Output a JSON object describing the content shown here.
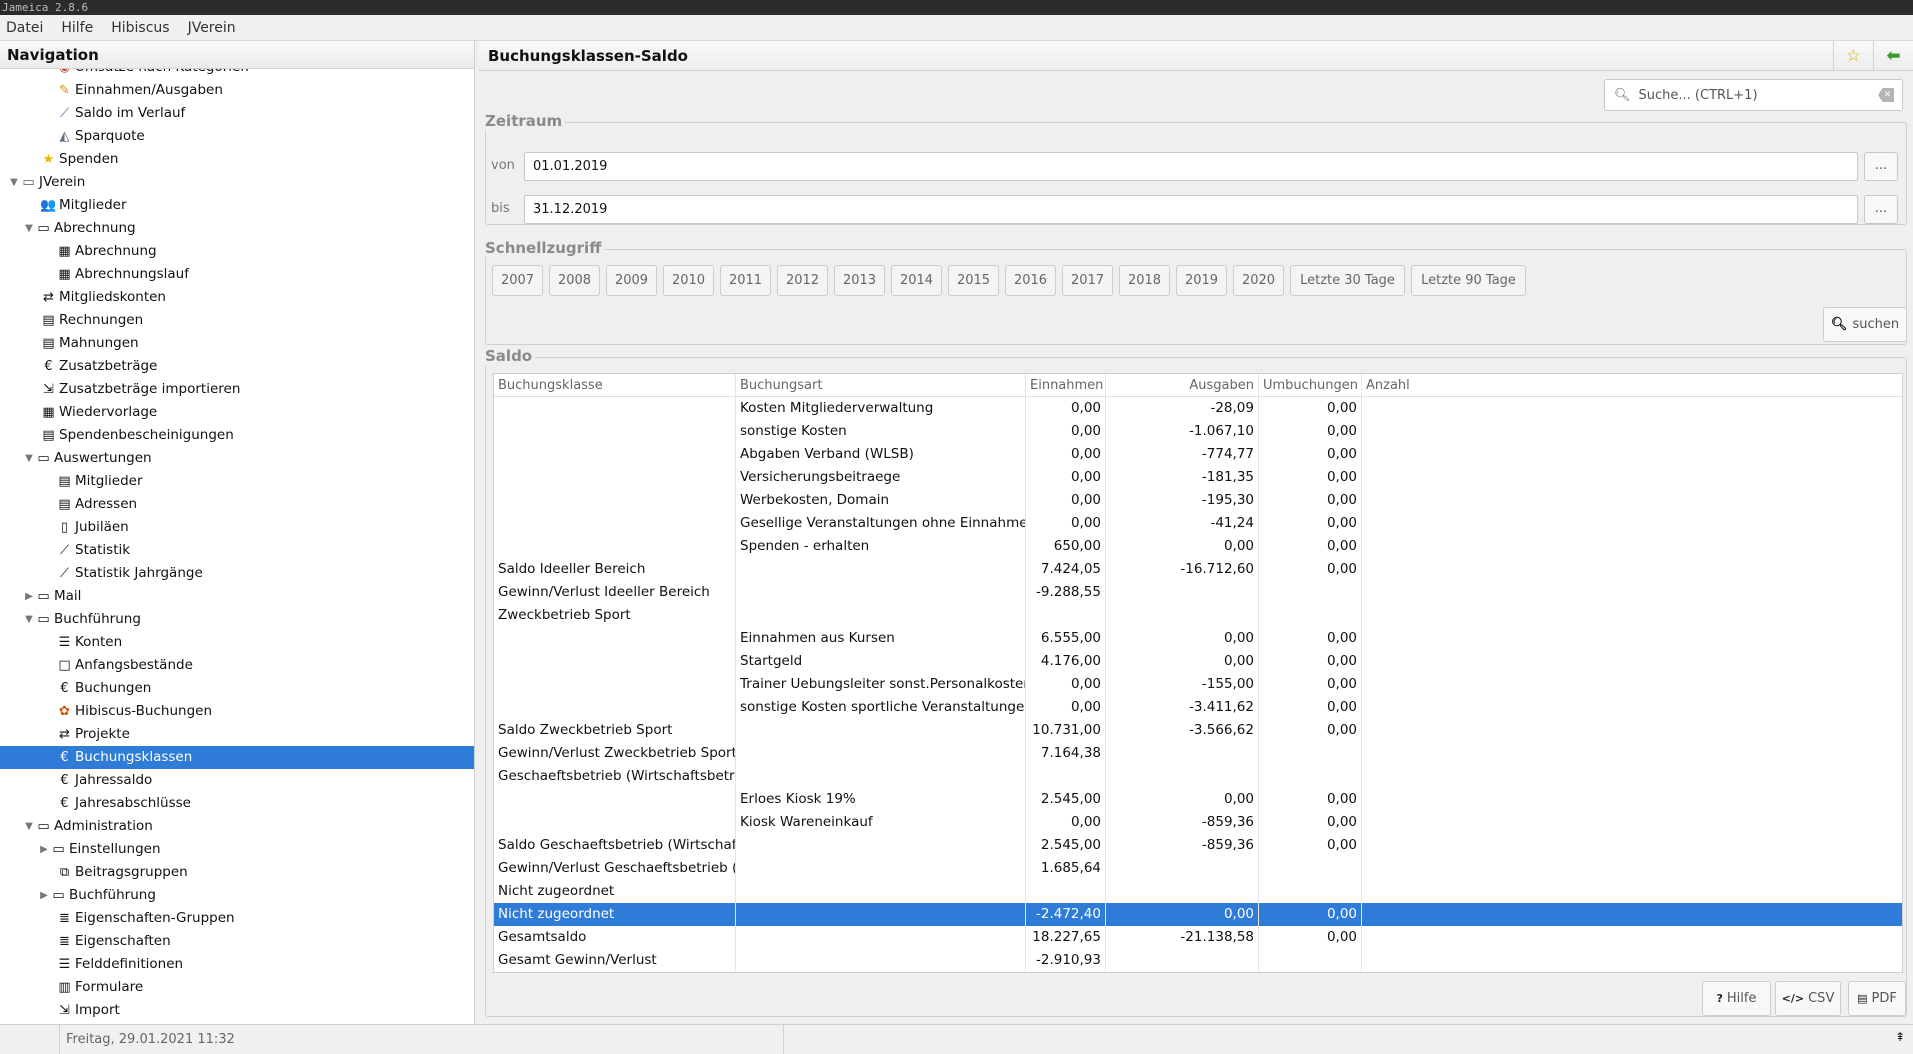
{
  "window": {
    "title": "Jameica 2.8.6"
  },
  "menu": [
    "Datei",
    "Hilfe",
    "Hibiscus",
    "JVerein"
  ],
  "nav": {
    "title": "Navigation",
    "items": [
      {
        "label": "Umsätze nach Kategorien",
        "level": 4,
        "icon": "chart-icon",
        "glyph": "◉",
        "color": "#c0392b"
      },
      {
        "label": "Einnahmen/Ausgaben",
        "level": 4,
        "icon": "income-expense-icon",
        "glyph": "✎",
        "color": "#d68910"
      },
      {
        "label": "Saldo im Verlauf",
        "level": 4,
        "icon": "line-chart-icon",
        "glyph": "⟋",
        "color": "#8e44ad"
      },
      {
        "label": "Sparquote",
        "level": 4,
        "icon": "savings-chart-icon",
        "glyph": "◭",
        "color": "#5d6d7e"
      },
      {
        "label": "Spenden",
        "level": 3,
        "icon": "star-icon",
        "glyph": "★",
        "color": "#e6b800"
      },
      {
        "label": "JVerein",
        "level": 1,
        "icon": "folder-open-icon",
        "glyph": "▭",
        "color": "#555",
        "toggle": "▼"
      },
      {
        "label": "Mitglieder",
        "level": 3,
        "icon": "users-icon",
        "glyph": "👥",
        "color": "#111"
      },
      {
        "label": "Abrechnung",
        "level": 2,
        "icon": "folder-open-icon",
        "glyph": "▭",
        "color": "#111",
        "toggle": "▼"
      },
      {
        "label": "Abrechnung",
        "level": 4,
        "icon": "calculator-icon",
        "glyph": "▦",
        "color": "#111"
      },
      {
        "label": "Abrechnungslauf",
        "level": 4,
        "icon": "calculator-icon",
        "glyph": "▦",
        "color": "#111"
      },
      {
        "label": "Mitgliedskonten",
        "level": 3,
        "icon": "transfer-icon",
        "glyph": "⇄",
        "color": "#111"
      },
      {
        "label": "Rechnungen",
        "level": 3,
        "icon": "document-icon",
        "glyph": "▤",
        "color": "#111"
      },
      {
        "label": "Mahnungen",
        "level": 3,
        "icon": "document-icon",
        "glyph": "▤",
        "color": "#111"
      },
      {
        "label": "Zusatzbeträge",
        "level": 3,
        "icon": "euro-icon",
        "glyph": "€",
        "color": "#111"
      },
      {
        "label": "Zusatzbeträge importieren",
        "level": 3,
        "icon": "import-icon",
        "glyph": "⇲",
        "color": "#111"
      },
      {
        "label": "Wiedervorlage",
        "level": 3,
        "icon": "calendar-icon",
        "glyph": "▦",
        "color": "#111"
      },
      {
        "label": "Spendenbescheinigungen",
        "level": 3,
        "icon": "document-icon",
        "glyph": "▤",
        "color": "#111"
      },
      {
        "label": "Auswertungen",
        "level": 2,
        "icon": "folder-open-icon",
        "glyph": "▭",
        "color": "#111",
        "toggle": "▼"
      },
      {
        "label": "Mitglieder",
        "level": 4,
        "icon": "list-report-icon",
        "glyph": "▤",
        "color": "#111"
      },
      {
        "label": "Adressen",
        "level": 4,
        "icon": "list-report-icon",
        "glyph": "▤",
        "color": "#111"
      },
      {
        "label": "Jubiläen",
        "level": 4,
        "icon": "page-icon",
        "glyph": "▯",
        "color": "#111"
      },
      {
        "label": "Statistik",
        "level": 4,
        "icon": "line-chart-icon",
        "glyph": "⟋",
        "color": "#111"
      },
      {
        "label": "Statistik Jahrgänge",
        "level": 4,
        "icon": "line-chart-icon",
        "glyph": "⟋",
        "color": "#111"
      },
      {
        "label": "Mail",
        "level": 2,
        "icon": "folder-icon",
        "glyph": "▭",
        "color": "#111",
        "toggle": "▶"
      },
      {
        "label": "Buchführung",
        "level": 2,
        "icon": "folder-open-icon",
        "glyph": "▭",
        "color": "#111",
        "toggle": "▼"
      },
      {
        "label": "Konten",
        "level": 4,
        "icon": "list-icon",
        "glyph": "☰",
        "color": "#111"
      },
      {
        "label": "Anfangsbestände",
        "level": 4,
        "icon": "box-icon",
        "glyph": "□",
        "color": "#111"
      },
      {
        "label": "Buchungen",
        "level": 4,
        "icon": "euro-icon",
        "glyph": "€",
        "color": "#111"
      },
      {
        "label": "Hibiscus-Buchungen",
        "level": 4,
        "icon": "hibiscus-icon",
        "glyph": "✿",
        "color": "#d35400"
      },
      {
        "label": "Projekte",
        "level": 4,
        "icon": "transfer-icon",
        "glyph": "⇄",
        "color": "#111"
      },
      {
        "label": "Buchungsklassen",
        "level": 4,
        "icon": "euro-icon",
        "glyph": "€",
        "color": "#111",
        "selected": true
      },
      {
        "label": "Jahressaldo",
        "level": 4,
        "icon": "euro-icon",
        "glyph": "€",
        "color": "#111"
      },
      {
        "label": "Jahresabschlüsse",
        "level": 4,
        "icon": "euro-icon",
        "glyph": "€",
        "color": "#111"
      },
      {
        "label": "Administration",
        "level": 2,
        "icon": "folder-open-icon",
        "glyph": "▭",
        "color": "#111",
        "toggle": "▼"
      },
      {
        "label": "Einstellungen",
        "level": 3.5,
        "icon": "folder-icon",
        "glyph": "▭",
        "color": "#111",
        "toggle": "▶"
      },
      {
        "label": "Beitragsgruppen",
        "level": 4,
        "icon": "groups-icon",
        "glyph": "⧉",
        "color": "#111"
      },
      {
        "label": "Buchführung",
        "level": 3.5,
        "icon": "folder-icon",
        "glyph": "▭",
        "color": "#111",
        "toggle": "▶"
      },
      {
        "label": "Eigenschaften-Gruppen",
        "level": 4,
        "icon": "database-icon",
        "glyph": "≣",
        "color": "#111"
      },
      {
        "label": "Eigenschaften",
        "level": 4,
        "icon": "database-icon",
        "glyph": "≣",
        "color": "#111"
      },
      {
        "label": "Felddefinitionen",
        "level": 4,
        "icon": "list-icon",
        "glyph": "☰",
        "color": "#111"
      },
      {
        "label": "Formulare",
        "level": 4,
        "icon": "form-icon",
        "glyph": "▥",
        "color": "#111"
      },
      {
        "label": "Import",
        "level": 4,
        "icon": "import-icon",
        "glyph": "⇲",
        "color": "#111"
      }
    ]
  },
  "main": {
    "title": "Buchungsklassen-Saldo",
    "search_placeholder": "Suche...   (CTRL+1)",
    "zeitraum": {
      "legend": "Zeitraum",
      "von_label": "von",
      "von_value": "01.01.2019",
      "bis_label": "bis",
      "bis_value": "31.12.2019",
      "dots": "..."
    },
    "schnellzugriff": {
      "legend": "Schnellzugriff",
      "buttons": [
        "2007",
        "2008",
        "2009",
        "2010",
        "2011",
        "2012",
        "2013",
        "2014",
        "2015",
        "2016",
        "2017",
        "2018",
        "2019",
        "2020",
        "Letzte 30 Tage",
        "Letzte 90 Tage"
      ]
    },
    "search_button": "suchen",
    "saldo": {
      "legend": "Saldo",
      "columns": [
        "Buchungsklasse",
        "Buchungsart",
        "Einnahmen",
        "Ausgaben",
        "Umbuchungen",
        "Anzahl"
      ],
      "rows": [
        [
          "",
          "Kosten Mitgliederverwaltung",
          "0,00",
          "-28,09",
          "0,00",
          ""
        ],
        [
          "",
          "sonstige Kosten",
          "0,00",
          "-1.067,10",
          "0,00",
          ""
        ],
        [
          "",
          "Abgaben Verband (WLSB)",
          "0,00",
          "-774,77",
          "0,00",
          ""
        ],
        [
          "",
          "Versicherungsbeitraege",
          "0,00",
          "-181,35",
          "0,00",
          ""
        ],
        [
          "",
          "Werbekosten, Domain",
          "0,00",
          "-195,30",
          "0,00",
          ""
        ],
        [
          "",
          "Gesellige Veranstaltungen ohne Einnahmen",
          "0,00",
          "-41,24",
          "0,00",
          ""
        ],
        [
          "",
          "Spenden - erhalten",
          "650,00",
          "0,00",
          "0,00",
          ""
        ],
        [
          "Saldo Ideeller Bereich",
          "",
          "7.424,05",
          "-16.712,60",
          "0,00",
          ""
        ],
        [
          "Gewinn/Verlust Ideeller Bereich",
          "",
          "-9.288,55",
          "",
          "",
          ""
        ],
        [
          "Zweckbetrieb Sport",
          "",
          "",
          "",
          "",
          ""
        ],
        [
          "",
          "Einnahmen aus Kursen",
          "6.555,00",
          "0,00",
          "0,00",
          ""
        ],
        [
          "",
          "Startgeld",
          "4.176,00",
          "0,00",
          "0,00",
          ""
        ],
        [
          "",
          "Trainer Uebungsleiter sonst.Personalkosten",
          "0,00",
          "-155,00",
          "0,00",
          ""
        ],
        [
          "",
          "sonstige Kosten sportliche Veranstaltungen",
          "0,00",
          "-3.411,62",
          "0,00",
          ""
        ],
        [
          "Saldo Zweckbetrieb Sport",
          "",
          "10.731,00",
          "-3.566,62",
          "0,00",
          ""
        ],
        [
          "Gewinn/Verlust Zweckbetrieb Sport",
          "",
          "7.164,38",
          "",
          "",
          ""
        ],
        [
          "Geschaeftsbetrieb (Wirtschaftsbetrieb)",
          "",
          "",
          "",
          "",
          ""
        ],
        [
          "",
          "Erloes Kiosk 19%",
          "2.545,00",
          "0,00",
          "0,00",
          ""
        ],
        [
          "",
          "Kiosk Wareneinkauf",
          "0,00",
          "-859,36",
          "0,00",
          ""
        ],
        [
          "Saldo Geschaeftsbetrieb (Wirtschaftsbetrieb)",
          "",
          "2.545,00",
          "-859,36",
          "0,00",
          ""
        ],
        [
          "Gewinn/Verlust Geschaeftsbetrieb (Wirtschaftsbetrieb)",
          "",
          "1.685,64",
          "",
          "",
          ""
        ],
        [
          "Nicht zugeordnet",
          "",
          "",
          "",
          "",
          ""
        ],
        [
          "Nicht zugeordnet",
          "",
          "-2.472,40",
          "0,00",
          "0,00",
          ""
        ],
        [
          "Gesamtsaldo",
          "",
          "18.227,65",
          "-21.138,58",
          "0,00",
          ""
        ],
        [
          "Gesamt Gewinn/Verlust",
          "",
          "-2.910,93",
          "",
          "",
          ""
        ]
      ],
      "selected_row": 22
    },
    "bottom_buttons": [
      {
        "label": "Hilfe",
        "icon": "help-icon",
        "glyph": "?"
      },
      {
        "label": "CSV",
        "icon": "code-icon",
        "glyph": "</>"
      },
      {
        "label": "PDF",
        "icon": "pdf-icon",
        "glyph": "▤"
      }
    ]
  },
  "status": {
    "datetime": "Freitag, 29.01.2021 11:32"
  }
}
